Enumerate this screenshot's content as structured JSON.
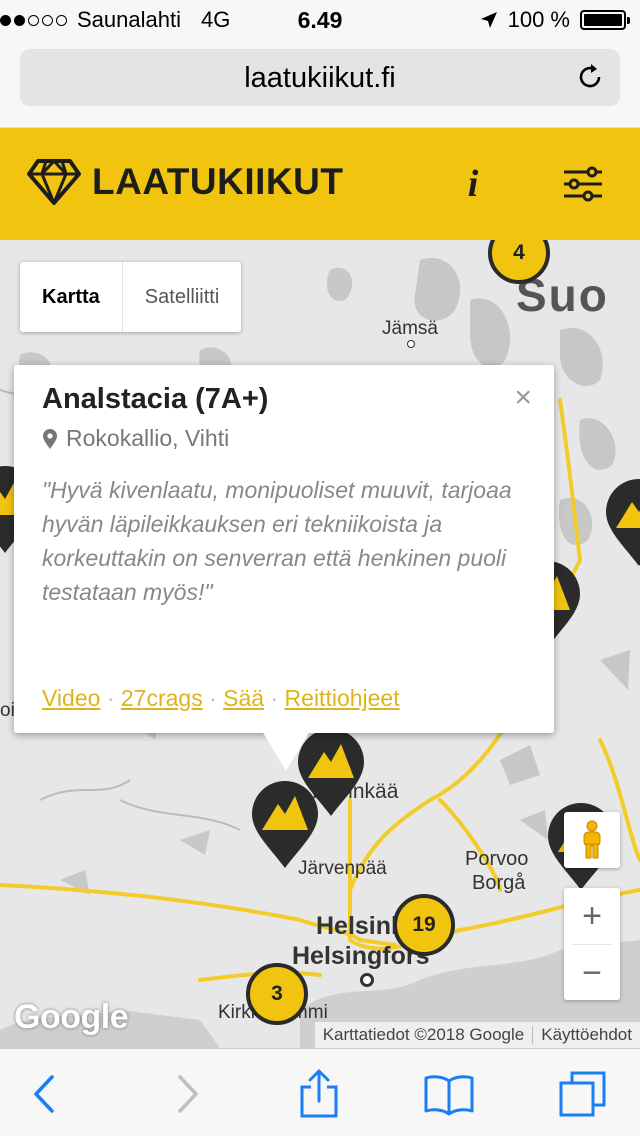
{
  "status": {
    "carrier": "Saunalahti",
    "network": "4G",
    "time": "6.49",
    "battery": "100 %",
    "signal_filled": 2,
    "signal_total": 5
  },
  "browser": {
    "url": "laatukiikut.fi"
  },
  "header": {
    "brand": "LAATUKIIKUT",
    "info_label": "i",
    "accent_color": "#f1c40f"
  },
  "map": {
    "type_options": [
      "Kartta",
      "Satelliitti"
    ],
    "places": {
      "jamsa": "Jämsä",
      "suo": "Suo",
      "hyvinkaa": "Hyvinkää",
      "jarvenpaa": "Järvenpää",
      "porvoo": "Porvoo",
      "borga": "Borgå",
      "helsinki": "Helsinki",
      "helsingfors": "Helsingfors",
      "kirkkonummi": "Kirkkonummi",
      "left_partial": "oi"
    },
    "clusters": {
      "top": "4",
      "helsinki": "19",
      "kirkkonummi": "3"
    },
    "google_logo": "Google",
    "map_data_credit": "Karttatiedot ©2018 Google",
    "terms": "Käyttöehdot",
    "zoom_in": "+",
    "zoom_out": "−"
  },
  "popup": {
    "title": "Analstacia (7A+)",
    "location": "Rokokallio, Vihti",
    "close": "×",
    "quote": "\"Hyvä kivenlaatu, monipuoliset muuvit, tarjoaa hyvän läpileikkauksen eri tekniikoista ja korkeuttakin on senverran että henkinen puoli testataan myös!\"",
    "links": {
      "video": "Video",
      "crags": "27crags",
      "weather": "Sää",
      "directions": "Reittiohjeet",
      "separator": "·"
    }
  }
}
